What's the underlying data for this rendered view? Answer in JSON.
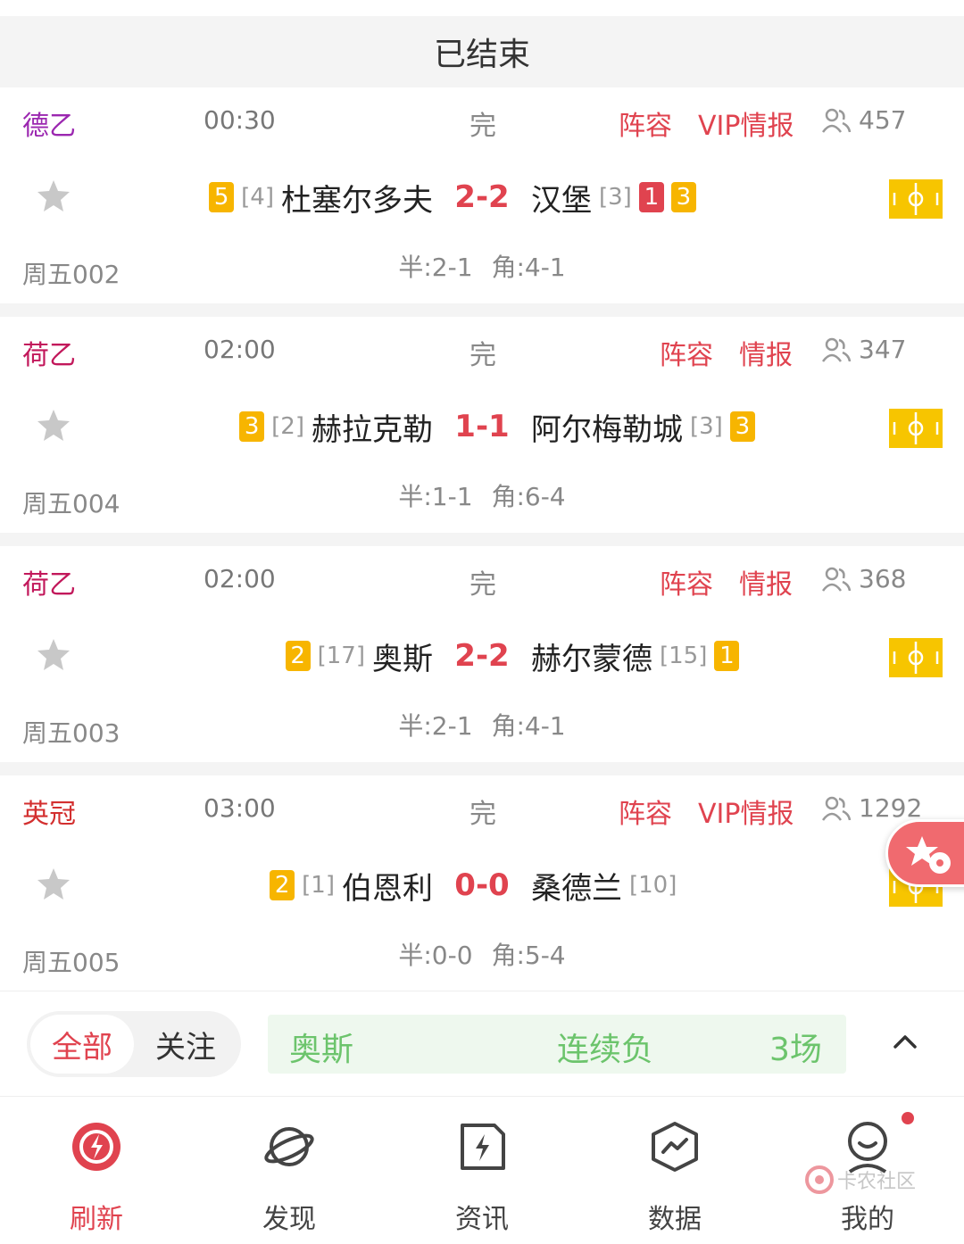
{
  "header": {
    "title": "已结束"
  },
  "icons": {
    "star": "star-icon",
    "people": "people-icon",
    "field": "football-field-icon",
    "caret": "chevron-up-icon",
    "float": "star-ball-icon"
  },
  "colors": {
    "accent": "#e0434f",
    "league_germany": "#9b27b0",
    "league_netherlands": "#c2185b",
    "league_england": "#d32f2f",
    "badge_yellow": "#f7b500",
    "ticker_green": "#6cc46c"
  },
  "matches": [
    {
      "league": "德乙",
      "league_color": "#9b27b0",
      "time": "00:30",
      "status": "完",
      "lineup": "阵容",
      "intel": "VIP情报",
      "viewers": "457",
      "home": {
        "yellow": "5",
        "rank": "[4]",
        "name": "杜塞尔多夫"
      },
      "score": "2-2",
      "away": {
        "name": "汉堡",
        "rank": "[3]",
        "red": "1",
        "yellow": "3"
      },
      "code": "周五002",
      "half": "半:2-1",
      "corner": "角:4-1"
    },
    {
      "league": "荷乙",
      "league_color": "#c2185b",
      "time": "02:00",
      "status": "完",
      "lineup": "阵容",
      "intel": "情报",
      "viewers": "347",
      "home": {
        "yellow": "3",
        "rank": "[2]",
        "name": "赫拉克勒"
      },
      "score": "1-1",
      "away": {
        "name": "阿尔梅勒城",
        "rank": "[3]",
        "red": "",
        "yellow": "3"
      },
      "code": "周五004",
      "half": "半:1-1",
      "corner": "角:6-4"
    },
    {
      "league": "荷乙",
      "league_color": "#c2185b",
      "time": "02:00",
      "status": "完",
      "lineup": "阵容",
      "intel": "情报",
      "viewers": "368",
      "home": {
        "yellow": "2",
        "rank": "[17]",
        "name": "奥斯"
      },
      "score": "2-2",
      "away": {
        "name": "赫尔蒙德",
        "rank": "[15]",
        "red": "",
        "yellow": "1"
      },
      "code": "周五003",
      "half": "半:2-1",
      "corner": "角:4-1"
    },
    {
      "league": "英冠",
      "league_color": "#d32f2f",
      "time": "03:00",
      "status": "完",
      "lineup": "阵容",
      "intel": "VIP情报",
      "viewers": "1292",
      "home": {
        "yellow": "2",
        "rank": "[1]",
        "name": "伯恩利"
      },
      "score": "0-0",
      "away": {
        "name": "桑德兰",
        "rank": "[10]",
        "red": "",
        "yellow": ""
      },
      "code": "周五005",
      "half": "半:0-0",
      "corner": "角:5-4"
    }
  ],
  "filter": {
    "all": "全部",
    "follow": "关注"
  },
  "ticker": {
    "team": "奥斯",
    "streak": "连续负",
    "count": "3场"
  },
  "tabs": [
    {
      "label": "刷新",
      "icon": "refresh-icon"
    },
    {
      "label": "发现",
      "icon": "planet-icon"
    },
    {
      "label": "资讯",
      "icon": "news-icon"
    },
    {
      "label": "数据",
      "icon": "data-icon"
    },
    {
      "label": "我的",
      "icon": "profile-icon"
    }
  ],
  "watermark": {
    "text": "卡农社区"
  }
}
